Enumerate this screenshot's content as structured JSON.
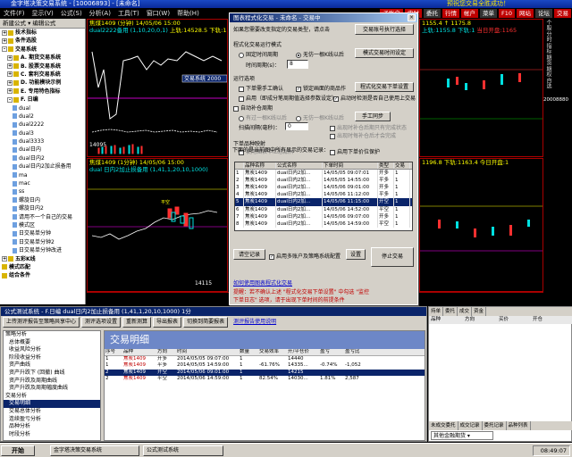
{
  "window": {
    "title": "金字塔决策交易系统 - [10006893] - [未命名]",
    "ticker": "预祝您交易全胜成功！"
  },
  "menu": {
    "items": [
      "文件(F)",
      "显示(V)",
      "公式(S)",
      "分析(A)",
      "工具(T)",
      "窗口(W)",
      "帮助(H)"
    ],
    "buttons": [
      "子账户",
      "实时",
      "委托",
      "行情",
      "帐户",
      "菜单",
      "F10",
      "网站",
      "论坛",
      "交易"
    ]
  },
  "left_panel": {
    "header": "新建公式 ▾ 编辑公式",
    "items": [
      {
        "label": "技术指标",
        "level": 0,
        "expand": "+",
        "bold": true
      },
      {
        "label": "条件选股",
        "level": 0,
        "expand": "+",
        "bold": true
      },
      {
        "label": "交易系统",
        "level": 0,
        "expand": "-",
        "bold": true
      },
      {
        "label": "A. 期货交易系统",
        "level": 1,
        "expand": "+",
        "bold": true
      },
      {
        "label": "B. 股票交易系统",
        "level": 1,
        "expand": "+",
        "bold": true
      },
      {
        "label": "C. 套利交易系统",
        "level": 1,
        "expand": "+",
        "bold": true
      },
      {
        "label": "D. 功能模块示例",
        "level": 1,
        "expand": "+",
        "bold": true
      },
      {
        "label": "E. 专用特色指标",
        "level": 1,
        "expand": "+",
        "bold": true
      },
      {
        "label": "F. 日编",
        "level": 1,
        "expand": "-",
        "bold": true
      },
      {
        "label": "dual",
        "level": 2
      },
      {
        "label": "dual2",
        "level": 2
      },
      {
        "label": "dual2222",
        "level": 2
      },
      {
        "label": "dual3",
        "level": 2
      },
      {
        "label": "dual3333",
        "level": 2
      },
      {
        "label": "dual日内",
        "level": 2
      },
      {
        "label": "dual日内2",
        "level": 2
      },
      {
        "label": "dual日内2加止损备用",
        "level": 2
      },
      {
        "label": "ma",
        "level": 2
      },
      {
        "label": "mac",
        "level": 2
      },
      {
        "label": "ss",
        "level": 2
      },
      {
        "label": "螺旋日内",
        "level": 2
      },
      {
        "label": "螺旋日内2",
        "level": 2
      },
      {
        "label": "请用不一个自己的交易",
        "level": 2
      },
      {
        "label": "模式区",
        "level": 2
      },
      {
        "label": "日交易单分钟",
        "level": 2
      },
      {
        "label": "日交易单分钟2",
        "level": 2
      },
      {
        "label": "日交易单分钟改进",
        "level": 2
      },
      {
        "label": "五彩K线",
        "level": 0,
        "expand": "+",
        "bold": true
      },
      {
        "label": "模式匹配",
        "level": 0,
        "bold": true
      },
      {
        "label": "组合条件",
        "level": 0,
        "bold": true
      }
    ]
  },
  "charts": {
    "top_left": {
      "title": "焦煤1409 (分钟) 14/05/06 15:00",
      "label": "dual2222备用 (1,10,20,0,1)",
      "info": "上轨:14528.5  下轨:1",
      "annotation": "交易系统 2000"
    },
    "mid_left": {
      "title": "焦煤1409 (1分钟) 14/05/06 15:00",
      "label": "dual 日内2加止损备用 (1,41,1,20,10,1000)",
      "info": "上轨:1",
      "annotation": "14115"
    },
    "top_right": {
      "title": "1155.4 ↑ 1175.8",
      "label": "上轨:1155.8 下轨:1",
      "info": "当日开盘:1165"
    },
    "mid_right": {
      "title": "1196.8  下轨:1163.4  今日开盘:1"
    },
    "price_left_top": "14095",
    "price_left_mid": "14115"
  },
  "dialog": {
    "title": "图表程式化交易 - 未命名 - 交易中",
    "intro": "如果您需要改变指定的交易类型，请点击",
    "intro_btn": "交易账号执行选择",
    "section1": "程式化交易运行模式",
    "radio_fixed": "固定时间周期",
    "radio_nolimit": "无仿一根K线以后",
    "btn_prog": "模式交易时间设定",
    "interval_label": "时间周期(s)：",
    "interval_value": "8",
    "section2": "运行选项",
    "opt1": "下单需手工确认",
    "opt2": "锁定画面的商品作",
    "opt_btn": "程式化交易下单设置",
    "opt3": "启用（即成分笔周期值选择参数设定）",
    "opt4": "启动时检测是否自己使用上交易",
    "auto_repeat": "自动补仓周期",
    "radio_a": "有过一根K线以后",
    "radio_b": "无仿一根K线以后",
    "btn_manual": "手工同步",
    "scan_label": "扫描间隔(毫秒)：",
    "scan_value": "0",
    "chk_a": "出现时补仓后期只有完成状态",
    "chk_b": "出现时每补仓后才会完成",
    "section3": "下单品种映射",
    "map1": "使用图表中汇总品种",
    "map2": "启用下单价位保护",
    "table_caption": "下面的是当前图中所有显示的交易记录：",
    "table_head": [
      "",
      "品种名称",
      "公式名称",
      "下单时间",
      "类型",
      "交易"
    ],
    "table_rows": [
      [
        "1",
        "焦炭1409",
        "dual日内2加...",
        "14/05/05 09:07:01",
        "开多",
        "1"
      ],
      [
        "2",
        "焦炭1409",
        "dual日内2加...",
        "14/05/05 14:55:00",
        "平多",
        "1"
      ],
      [
        "3",
        "焦炭1409",
        "dual日内2加...",
        "14/05/06 09:01:00",
        "开多",
        "1"
      ],
      [
        "4",
        "焦炭1409",
        "dual日内2加...",
        "14/05/06 11:12:00",
        "平多",
        "1"
      ],
      [
        "5",
        "焦炭1409",
        "dual日内2加...",
        "14/05/06 11:15:00",
        "开空",
        "1"
      ],
      [
        "6",
        "焦炭1409",
        "dual日内2加...",
        "14/05/06 14:52:00",
        "平空",
        "1"
      ],
      [
        "7",
        "焦炭1409",
        "dual日内2加...",
        "14/05/06 09:07:00",
        "开多",
        "1"
      ],
      [
        "8",
        "焦炭1409",
        "dual日内2加...",
        "14/05/06 14:59:00",
        "平空",
        "1"
      ]
    ],
    "btn_record": "请空记录",
    "chk_multi": "启用多账户及策略系统配置",
    "btn_setting": "设置",
    "btn_stop": "停止交易",
    "link": "如何使用图表程式化交易",
    "note1": "提醒：若不确认上述 \"程式化交易下单设置\" 中勾选 \"监控",
    "note2": "下单日志\" 选项，请于出现下单时间的前提条件"
  },
  "right_side": {
    "tabs": [
      "个股",
      "分时",
      "指标",
      "期货",
      "期权",
      "自选"
    ],
    "account": "20008880"
  },
  "bottom": {
    "title": "公式测试系统 - F.日编  dual日内2加止损备用 (1,41,1,20,10,1000) 1分",
    "toolbar": [
      "上传测评报告至策略共享中心",
      "测评选项设置",
      "重新测算",
      "导出报表",
      "切换到简要报表"
    ],
    "link": "测评报告使用说明",
    "side_items": [
      {
        "label": "策略分析",
        "group": true
      },
      {
        "label": "总体概要"
      },
      {
        "label": "收益风险分析"
      },
      {
        "label": "阶段收益分析"
      },
      {
        "label": "资产曲线"
      },
      {
        "label": "资产升跌下 (回撤) 曲线"
      },
      {
        "label": "资产升跌及周期曲线"
      },
      {
        "label": "资产升跌及周期幅度曲线"
      },
      {
        "label": "交易分析",
        "group": true
      },
      {
        "label": "交易明细",
        "sel": true
      },
      {
        "label": "交易总体分析"
      },
      {
        "label": "连续盈亏分析"
      },
      {
        "label": "品种分析"
      },
      {
        "label": "时段分析"
      }
    ],
    "heading": "交易明细",
    "table_head": [
      "序号",
      "品种",
      "方向",
      "时间",
      "数量",
      "交易效率",
      "开/平仓价",
      "盈亏",
      "盈亏比"
    ],
    "table_rows": [
      [
        "1",
        "焦炭1409",
        "开多",
        "2014/05/05 09:07:00",
        "1",
        "",
        "14440",
        "",
        ""
      ],
      [
        "1",
        "焦炭1409",
        "平多",
        "2014/05/05 14:59:00",
        "1",
        "-61.76%",
        "14335...",
        "-0.74%",
        "-1,052"
      ],
      [
        "2",
        "焦炭1409",
        "开空",
        "2014/05/06 09:01:00",
        "1",
        "",
        "14215",
        "",
        ""
      ],
      [
        "2",
        "焦炭1409",
        "平空",
        "2014/05/06 14:59:00",
        "1",
        "82.54%",
        "14030...",
        "1.81%",
        "2,587"
      ]
    ]
  },
  "bottom_right": {
    "tabs": [
      "持单",
      "委托",
      "成交",
      "资金"
    ],
    "head": [
      "品种",
      "方向",
      "买价",
      "开仓"
    ],
    "bottom_tabs": [
      "未成交委托",
      "成交记录",
      "委托记录",
      "品种列表"
    ],
    "label": "其他金融期货"
  },
  "taskbar": {
    "start": "开始",
    "tasks": [
      "金字塔决策交易系统",
      "公式测试系统"
    ],
    "clock": "08:49:07"
  }
}
